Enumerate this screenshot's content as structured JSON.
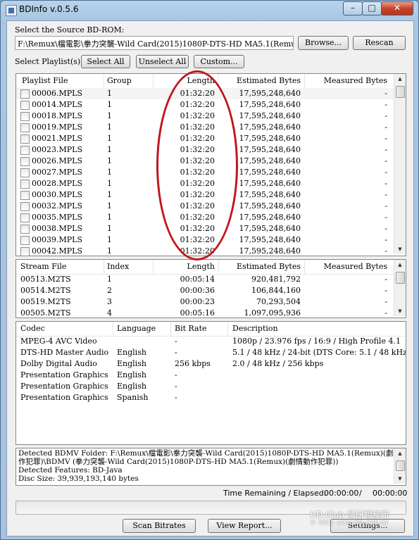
{
  "window": {
    "title": "BDInfo v.0.5.6",
    "controls": {
      "minimize": "–",
      "maximize": "□",
      "close": "✕"
    }
  },
  "source": {
    "label": "Select the Source BD-ROM:",
    "path": "F:\\Remux\\檔電影\\拳力突襲-Wild Card(2015)1080P-DTS-HD MA5.1(Remux)(劇",
    "browse_label": "Browse...",
    "rescan_label": "Rescan"
  },
  "playlist_select": {
    "label": "Select Playlist(s):",
    "select_all": "Select All",
    "unselect_all": "Unselect All",
    "custom": "Custom..."
  },
  "playlist_table": {
    "columns": [
      "Playlist File",
      "Group",
      "Length",
      "Estimated Bytes",
      "Measured Bytes"
    ],
    "rows": [
      {
        "file": "00006.MPLS",
        "group": "1",
        "length": "01:32:20",
        "est": "17,595,248,640",
        "meas": "-"
      },
      {
        "file": "00014.MPLS",
        "group": "1",
        "length": "01:32:20",
        "est": "17,595,248,640",
        "meas": "-"
      },
      {
        "file": "00018.MPLS",
        "group": "1",
        "length": "01:32:20",
        "est": "17,595,248,640",
        "meas": "-"
      },
      {
        "file": "00019.MPLS",
        "group": "1",
        "length": "01:32:20",
        "est": "17,595,248,640",
        "meas": "-"
      },
      {
        "file": "00021.MPLS",
        "group": "1",
        "length": "01:32:20",
        "est": "17,595,248,640",
        "meas": "-"
      },
      {
        "file": "00023.MPLS",
        "group": "1",
        "length": "01:32:20",
        "est": "17,595,248,640",
        "meas": "-"
      },
      {
        "file": "00026.MPLS",
        "group": "1",
        "length": "01:32:20",
        "est": "17,595,248,640",
        "meas": "-"
      },
      {
        "file": "00027.MPLS",
        "group": "1",
        "length": "01:32:20",
        "est": "17,595,248,640",
        "meas": "-"
      },
      {
        "file": "00028.MPLS",
        "group": "1",
        "length": "01:32:20",
        "est": "17,595,248,640",
        "meas": "-"
      },
      {
        "file": "00030.MPLS",
        "group": "1",
        "length": "01:32:20",
        "est": "17,595,248,640",
        "meas": "-"
      },
      {
        "file": "00032.MPLS",
        "group": "1",
        "length": "01:32:20",
        "est": "17,595,248,640",
        "meas": "-"
      },
      {
        "file": "00035.MPLS",
        "group": "1",
        "length": "01:32:20",
        "est": "17,595,248,640",
        "meas": "-"
      },
      {
        "file": "00038.MPLS",
        "group": "1",
        "length": "01:32:20",
        "est": "17,595,248,640",
        "meas": "-"
      },
      {
        "file": "00039.MPLS",
        "group": "1",
        "length": "01:32:20",
        "est": "17,595,248,640",
        "meas": "-"
      },
      {
        "file": "00042.MPLS",
        "group": "1",
        "length": "01:32:20",
        "est": "17,595,248,640",
        "meas": "-"
      }
    ]
  },
  "stream_table": {
    "columns": [
      "Stream File",
      "Index",
      "Length",
      "Estimated Bytes",
      "Measured Bytes"
    ],
    "rows": [
      {
        "file": "00513.M2TS",
        "index": "1",
        "length": "00:05:14",
        "est": "920,481,792",
        "meas": "-"
      },
      {
        "file": "00514.M2TS",
        "index": "2",
        "length": "00:00:36",
        "est": "106,844,160",
        "meas": "-"
      },
      {
        "file": "00519.M2TS",
        "index": "3",
        "length": "00:00:23",
        "est": "70,293,504",
        "meas": "-"
      },
      {
        "file": "00505.M2TS",
        "index": "4",
        "length": "00:05:16",
        "est": "1,097,095,936",
        "meas": "-"
      }
    ]
  },
  "codec_table": {
    "columns": [
      "Codec",
      "Language",
      "Bit Rate",
      "Description"
    ],
    "rows": [
      {
        "codec": "MPEG-4 AVC Video",
        "lang": "",
        "bitrate": "-",
        "desc": "1080p / 23.976 fps / 16:9 / High Profile 4.1"
      },
      {
        "codec": "DTS-HD Master Audio",
        "lang": "English",
        "bitrate": "-",
        "desc": "5.1 / 48 kHz / 24-bit (DTS Core: 5.1 / 48 kHz /"
      },
      {
        "codec": "Dolby Digital Audio",
        "lang": "English",
        "bitrate": "256 kbps",
        "desc": "2.0 / 48 kHz / 256 kbps"
      },
      {
        "codec": "Presentation Graphics",
        "lang": "English",
        "bitrate": "-",
        "desc": ""
      },
      {
        "codec": "Presentation Graphics",
        "lang": "English",
        "bitrate": "-",
        "desc": ""
      },
      {
        "codec": "Presentation Graphics",
        "lang": "Spanish",
        "bitrate": "-",
        "desc": ""
      }
    ]
  },
  "log": {
    "lines": [
      "Detected BDMV Folder: F:\\Remux\\檔電影\\拳力突襲-Wild Card(2015)1080P-DTS-HD MA5.1(Remux)(劇情動",
      "作犯罪)\\BDMV (拳力突襲-Wild Card(2015)1080P-DTS-HD MA5.1(Remux)(劇情動作犯罪))",
      "Detected Features: BD-Java",
      "Disc Size: 39,939,193,140 bytes"
    ]
  },
  "time": {
    "label": "Time Remaining / Elapsed:",
    "remaining": "00:00:00",
    "separator": "/",
    "elapsed": "00:00:00"
  },
  "progress": {
    "value": 0
  },
  "bottom": {
    "scan_bitrates": "Scan Bitrates",
    "view_report": "View Report...",
    "settings": "Settings..."
  },
  "watermark": {
    "line1": "HD.Club 情研視務所",
    "line2": "© 2015 www.HD.club.tw"
  }
}
